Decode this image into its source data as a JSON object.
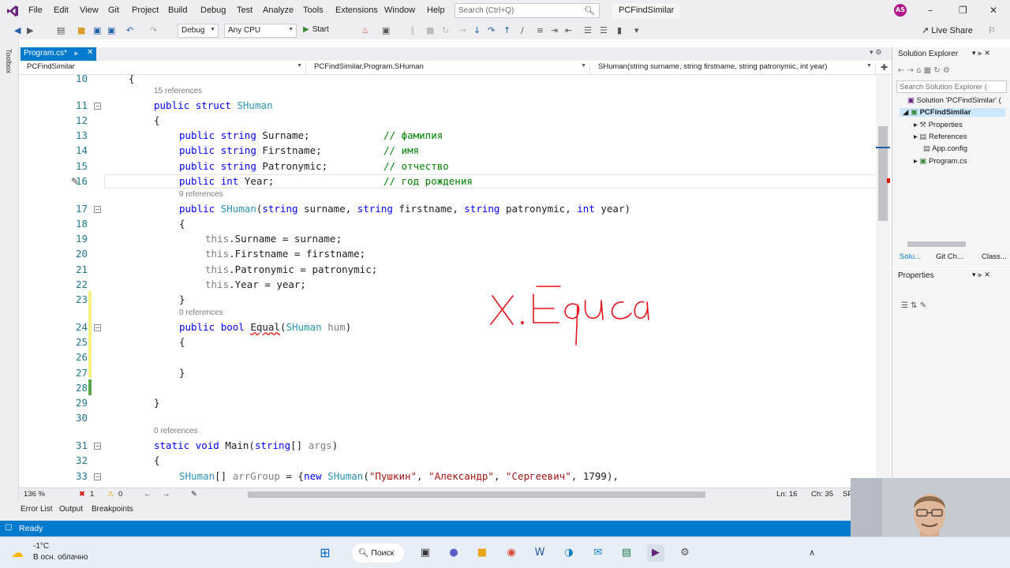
{
  "menu": {
    "items": [
      "File",
      "Edit",
      "View",
      "Git",
      "Project",
      "Build",
      "Debug",
      "Test",
      "Analyze",
      "Tools",
      "Extensions",
      "Window",
      "Help"
    ],
    "search_placeholder": "Search (Ctrl+Q)",
    "solution_name": "PCFindSimilar",
    "avatar_initials": "AS"
  },
  "toolbar": {
    "config": "Debug",
    "platform": "Any CPU",
    "start_label": "Start",
    "live_share_label": "Live Share"
  },
  "left_strip": {
    "toolbox_label": "Toolbox"
  },
  "document_tab": {
    "label": "Program.cs*"
  },
  "navbar": {
    "project": "PCFindSimilar",
    "type": "PCFindSimilar.Program.SHuman",
    "member": "SHuman(string surname, string firstname, string patronymic, int year)"
  },
  "editor": {
    "refs": {
      "r15": "15 references",
      "r9": "9 references",
      "r0a": "0 references",
      "r0b": "0 references"
    },
    "line_numbers": [
      "10",
      "11",
      "12",
      "13",
      "14",
      "15",
      "16",
      "17",
      "18",
      "19",
      "20",
      "21",
      "22",
      "23",
      "24",
      "25",
      "26",
      "27",
      "28",
      "29",
      "30",
      "31",
      "32",
      "33"
    ],
    "comments": {
      "c13": "// фамилия",
      "c14": "// имя",
      "c15": "// отчество",
      "c16": "// год рождения"
    },
    "strings": {
      "s1": "\"Пушкин\"",
      "s2": "\"Александр\"",
      "s3": "\"Сергеевич\""
    },
    "year_value": "1799",
    "handwriting": "X.Equa"
  },
  "editor_status": {
    "zoom": "136 %",
    "errors": "1",
    "warnings": "0",
    "line": "Ln: 16",
    "col": "Ch: 35",
    "mode": "SPC"
  },
  "bottom_tabs": [
    "Error List",
    "Output",
    "Breakpoints"
  ],
  "statusbar": {
    "text": "Ready"
  },
  "solution_explorer": {
    "title": "Solution Explorer",
    "search_placeholder": "Search Solution Explorer (",
    "solution": "Solution 'PCFindSimilar' (",
    "project": "PCFindSimilar",
    "items": [
      "Properties",
      "References",
      "App.config",
      "Program.cs"
    ],
    "tabs": [
      "Solu...",
      "Git Ch...",
      "Class..."
    ]
  },
  "properties": {
    "title": "Properties"
  },
  "taskbar": {
    "temperature": "-1°C",
    "weather": "В осн. облачно",
    "search_label": "Поиск"
  },
  "colors": {
    "accent": "#007acc",
    "keyword": "#0000ff",
    "type": "#2b91af",
    "comment": "#008000",
    "string": "#a31515",
    "ink": "#e3141c"
  }
}
